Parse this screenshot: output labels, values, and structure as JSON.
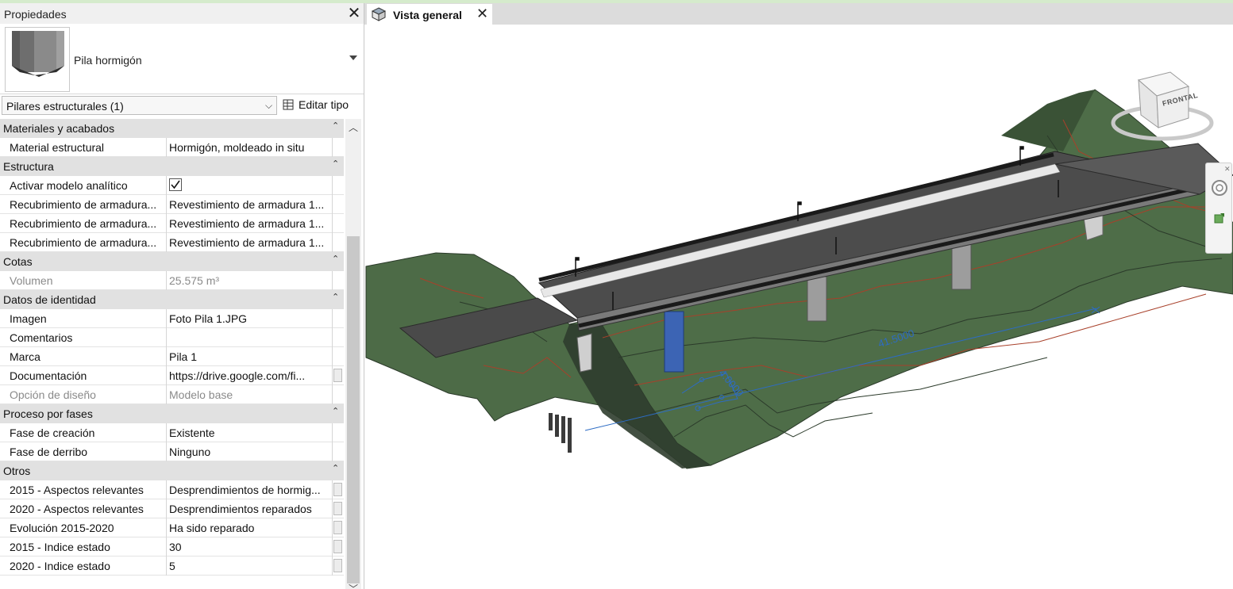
{
  "properties": {
    "title": "Propiedades",
    "type_name": "Pila hormigón",
    "filter": "Pilares estructurales (1)",
    "edit_type_label": "Editar tipo",
    "sections": [
      {
        "title": "Materiales y acabados",
        "rows": [
          {
            "key": "Material estructural",
            "value": "Hormigón, moldeado in situ"
          }
        ]
      },
      {
        "title": "Estructura",
        "rows": [
          {
            "key": "Activar modelo analítico",
            "value": "",
            "checked": true
          },
          {
            "key": "Recubrimiento de armadura...",
            "value": "Revestimiento de armadura 1..."
          },
          {
            "key": "Recubrimiento de armadura...",
            "value": "Revestimiento de armadura 1..."
          },
          {
            "key": "Recubrimiento de armadura...",
            "value": "Revestimiento de armadura 1..."
          }
        ]
      },
      {
        "title": "Cotas",
        "rows": [
          {
            "key": "Volumen",
            "value": "25.575 m³",
            "dim": true
          }
        ]
      },
      {
        "title": "Datos de identidad",
        "rows": [
          {
            "key": "Imagen",
            "value": "Foto Pila 1.JPG"
          },
          {
            "key": "Comentarios",
            "value": ""
          },
          {
            "key": "Marca",
            "value": "Pila 1"
          },
          {
            "key": "Documentación",
            "value": "https://drive.google.com/fi...",
            "button": true
          },
          {
            "key": "Opción de diseño",
            "value": "Modelo base",
            "dim": true
          }
        ]
      },
      {
        "title": "Proceso por fases",
        "rows": [
          {
            "key": "Fase de creación",
            "value": "Existente"
          },
          {
            "key": "Fase de derribo",
            "value": "Ninguno"
          }
        ]
      },
      {
        "title": "Otros",
        "rows": [
          {
            "key": "2015 - Aspectos relevantes",
            "value": "Desprendimientos de hormig...",
            "button": true
          },
          {
            "key": "2020 - Aspectos relevantes",
            "value": "Desprendimientos reparados",
            "button": true
          },
          {
            "key": "Evolución 2015-2020",
            "value": "Ha sido reparado",
            "button": true
          },
          {
            "key": "2015 - Indice estado",
            "value": "30",
            "button": true
          },
          {
            "key": "2020 - Indice estado",
            "value": "5",
            "button": true
          }
        ]
      }
    ]
  },
  "view": {
    "tab_label": "Vista general",
    "dimension_label": "41.5000",
    "dimension_label_small": "4.0000",
    "viewcube_face": "FRONTAL"
  },
  "colors": {
    "terrain": "#4d6b47",
    "terrain_dark": "#3f5a3a",
    "contour_red": "#a8402a",
    "contour_dark": "#2b3a2a",
    "road": "#4a4a4a",
    "selected_pier": "#3c64b4",
    "dimension": "#2d6cc4"
  }
}
